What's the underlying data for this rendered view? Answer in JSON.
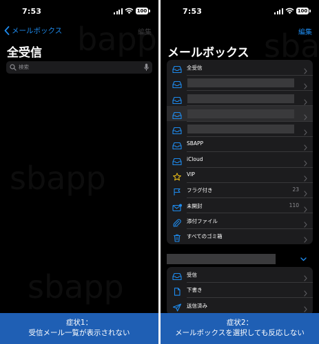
{
  "left": {
    "status": {
      "time": "7:53",
      "battery": "100"
    },
    "nav": {
      "back_label": "メールボックス",
      "edit_label": "編集"
    },
    "title": "全受信",
    "search": {
      "placeholder": "検索"
    },
    "watermark": [
      "bapp",
      "sbapp",
      "sbapp"
    ]
  },
  "right": {
    "status": {
      "time": "7:53",
      "battery": "100"
    },
    "nav": {
      "edit_label": "編集"
    },
    "title": "メールボックス",
    "group1": [
      {
        "label": "全受信",
        "icon": "tray-icon",
        "count": ""
      },
      {
        "label": "",
        "icon": "tray-icon",
        "count": "",
        "redacted": true
      },
      {
        "label": "",
        "icon": "tray-icon",
        "count": "",
        "redacted": true
      },
      {
        "label": "",
        "icon": "tray-icon",
        "count": "",
        "redacted": true,
        "selected": true
      },
      {
        "label": "",
        "icon": "tray-icon",
        "count": "",
        "redacted": true
      },
      {
        "label": "SBAPP",
        "icon": "tray-icon",
        "count": ""
      },
      {
        "label": "iCloud",
        "icon": "tray-icon",
        "count": ""
      },
      {
        "label": "VIP",
        "icon": "star-icon",
        "count": ""
      },
      {
        "label": "フラグ付き",
        "icon": "flag-icon",
        "count": "23"
      },
      {
        "label": "未開封",
        "icon": "unread-envelope-icon",
        "count": "110"
      },
      {
        "label": "添付ファイル",
        "icon": "paperclip-icon",
        "count": ""
      },
      {
        "label": "すべてのゴミ箱",
        "icon": "trash-icon",
        "count": ""
      }
    ],
    "group2": [
      {
        "label": "受信",
        "icon": "tray-icon",
        "count": ""
      },
      {
        "label": "下書き",
        "icon": "document-icon",
        "count": ""
      },
      {
        "label": "送信済み",
        "icon": "paperplane-icon",
        "count": ""
      }
    ],
    "watermark": [
      "sbapp",
      "sbapp"
    ]
  },
  "captions": {
    "left_line1": "症状1：",
    "left_line2": "受信メール一覧が表示されない",
    "right_line1": "症状2：",
    "right_line2": "メールボックスを選択しても反応しない"
  },
  "colors": {
    "accent": "#1e8cf0",
    "caption_bg": "#1f5fb4",
    "panel_bg": "#000000",
    "group_bg": "#1c1c1e"
  }
}
